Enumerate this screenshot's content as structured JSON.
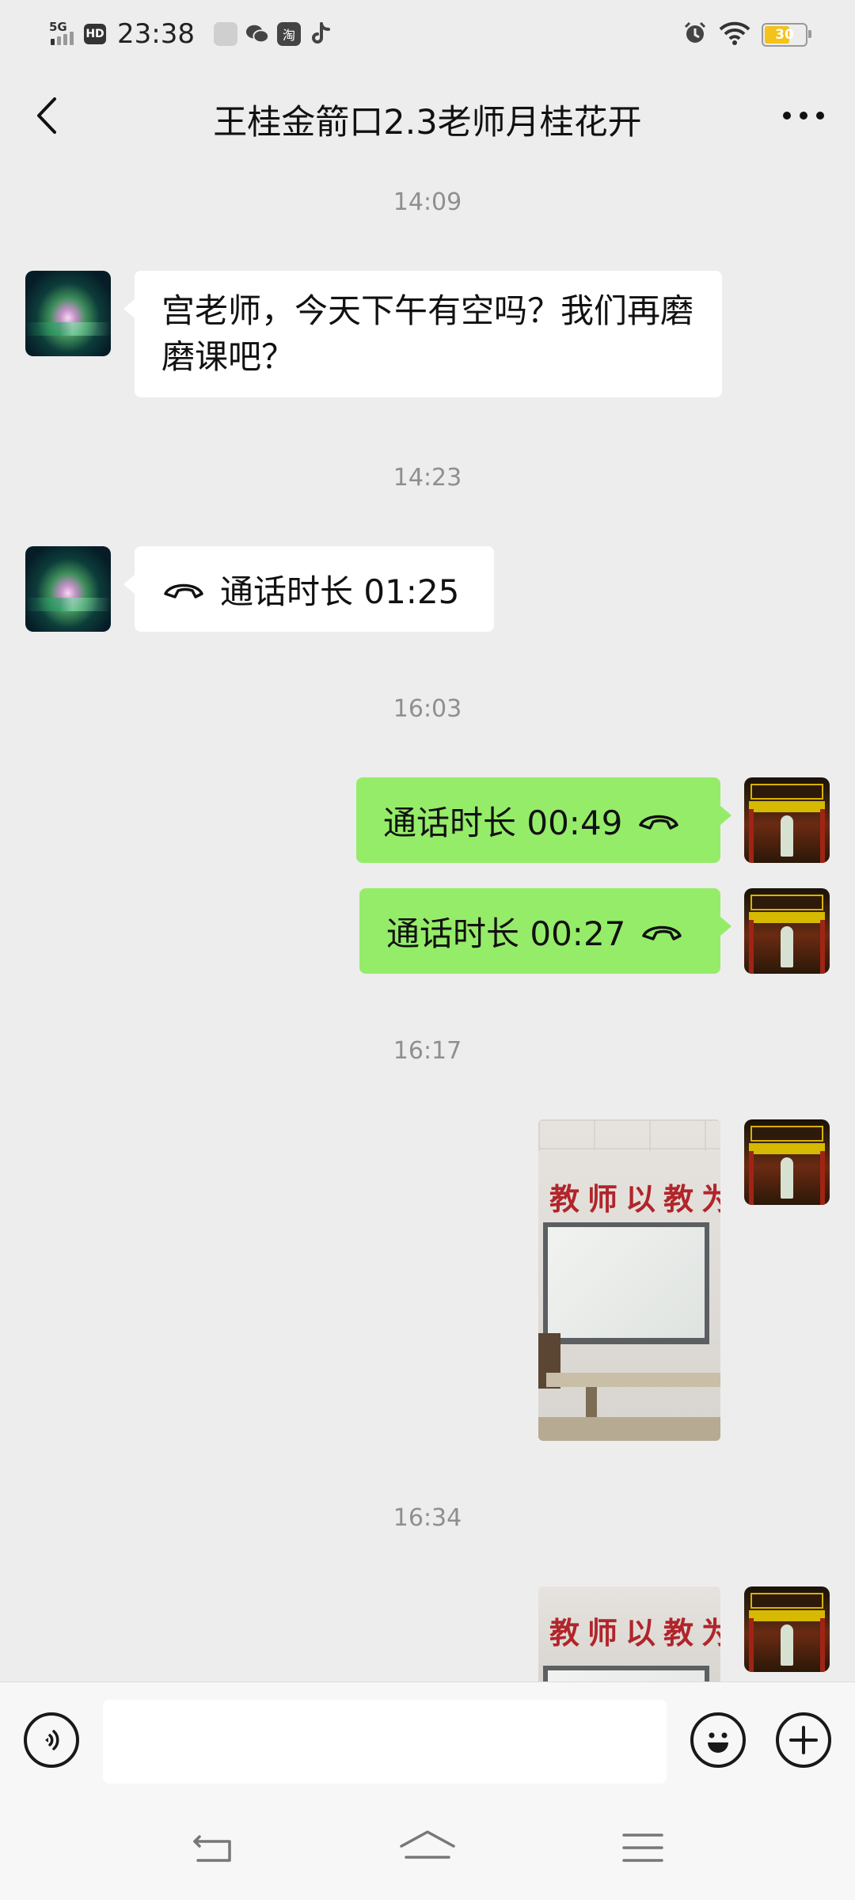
{
  "status_bar": {
    "network": "5G",
    "hd_label": "HD",
    "time": "23:38",
    "app_icon_taobao": "淘",
    "battery_level": "30"
  },
  "header": {
    "title": "王桂金箭口2.3老师月桂花开"
  },
  "chat": {
    "timestamps": [
      "14:09",
      "14:23",
      "16:03",
      "16:17",
      "16:34"
    ],
    "messages": [
      {
        "type": "text",
        "direction": "incoming",
        "text": "宫老师，今天下午有空吗？我们再磨磨课吧？"
      },
      {
        "type": "call",
        "direction": "incoming",
        "text": "通话时长 01:25"
      },
      {
        "type": "call",
        "direction": "outgoing",
        "text": "通话时长 00:49"
      },
      {
        "type": "call",
        "direction": "outgoing",
        "text": "通话时长 00:27"
      },
      {
        "type": "image",
        "direction": "outgoing"
      },
      {
        "type": "image",
        "direction": "outgoing"
      }
    ],
    "photo_slogan": "教师以教为"
  },
  "input_bar": {
    "voice_icon": "voice-icon",
    "emoji_icon": "emoji-icon",
    "add_icon": "plus-icon"
  },
  "colors": {
    "background": "#ededed",
    "outgoing_bubble": "#95ec69",
    "incoming_bubble": "#ffffff"
  }
}
